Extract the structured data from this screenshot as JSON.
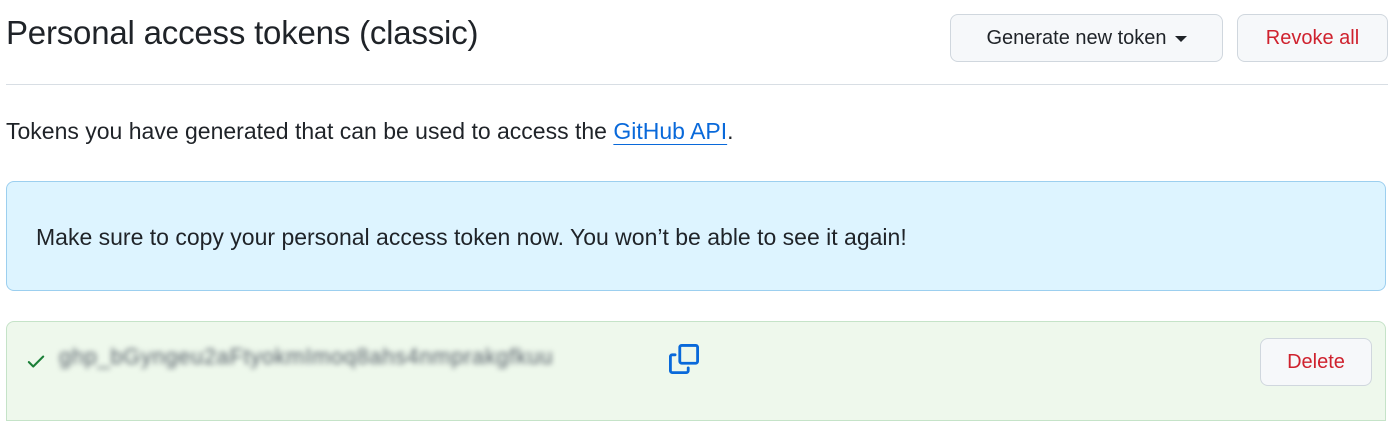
{
  "header": {
    "title": "Personal access tokens (classic)",
    "generate_label": "Generate new token",
    "revoke_label": "Revoke all"
  },
  "description": {
    "text": "Tokens you have generated that can be used to access the ",
    "link_text": "GitHub API",
    "suffix": "."
  },
  "flash": {
    "message": "Make sure to copy your personal access token now. You won’t be able to see it again!"
  },
  "token": {
    "value": "ghp_bGyngeu2aFtyokmImoq8ahs4nmprakgfkuu",
    "delete_label": "Delete"
  },
  "colors": {
    "danger": "#cf222e",
    "link": "#0969da",
    "success": "#1a7f37",
    "info_bg": "#ddf4ff",
    "success_bg": "#eef8ec"
  },
  "icons": [
    "check-icon",
    "copy-icon",
    "caret-down-icon"
  ]
}
